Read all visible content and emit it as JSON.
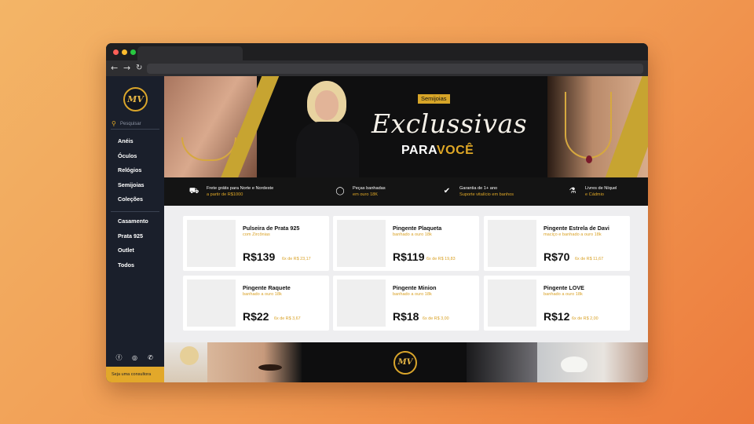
{
  "browser": {
    "icons": {
      "back": "arrow-left-icon",
      "forward": "arrow-right-icon",
      "reload": "reload-icon"
    }
  },
  "sidebar": {
    "logo_text": "MV",
    "search_placeholder": "Pesquisar",
    "menu_primary": [
      "Anéis",
      "Óculos",
      "Relógios",
      "Semijoias",
      "Coleções"
    ],
    "menu_secondary": [
      "Casamento",
      "Prata 925",
      "Outlet",
      "Todos"
    ],
    "social_icons": [
      "facebook-icon",
      "instagram-icon",
      "whatsapp-icon"
    ],
    "cta": "Seja uma consultora"
  },
  "hero": {
    "badge": "Semijoias",
    "headline": "Exclussivas",
    "tagline_prefix": "PARA",
    "tagline_highlight": "VOCÊ"
  },
  "features": [
    {
      "icon": "truck-icon",
      "line1": "Frete grátis para Norte e Nordeste",
      "line2": "a partir de R$1000"
    },
    {
      "icon": "ring-icon",
      "line1": "Peças banhadas",
      "line2": "em ouro 18K"
    },
    {
      "icon": "shield-check-icon",
      "line1": "Garantia de 1+ ano",
      "line2": "Suporte vitalício em banhos"
    },
    {
      "icon": "flask-icon",
      "line1": "Livres de Níquel",
      "line2": "e Cádmio"
    }
  ],
  "products": [
    {
      "name": "Pulseira de Prata 925",
      "subtitle": "com Zircônias",
      "price": "R$139",
      "installments": "6x de R$ 23,17"
    },
    {
      "name": "Pingente Plaqueta",
      "subtitle": "banhado a ouro 18k",
      "price": "R$119",
      "installments": "6x de R$ 19,83"
    },
    {
      "name": "Pingente Estrela de Davi",
      "subtitle": "maciço e banhado a ouro 18k",
      "price": "R$70",
      "installments": "6x de R$ 11,67"
    },
    {
      "name": "Pingente Raquete",
      "subtitle": "banhado a ouro 18k",
      "price": "R$22",
      "installments": "6x de R$ 3,67"
    },
    {
      "name": "Pingente Minion",
      "subtitle": "banhado a ouro 18k",
      "price": "R$18",
      "installments": "6x de R$ 3,00"
    },
    {
      "name": "Pingente LOVE",
      "subtitle": "banhado a ouro 18k",
      "price": "R$12",
      "installments": "6x de R$ 2,00"
    }
  ],
  "banner2": {
    "logo_text": "MV"
  },
  "colors": {
    "accent": "#e0a826",
    "sidebar": "#1a1f2b",
    "background": "#efeff1"
  }
}
